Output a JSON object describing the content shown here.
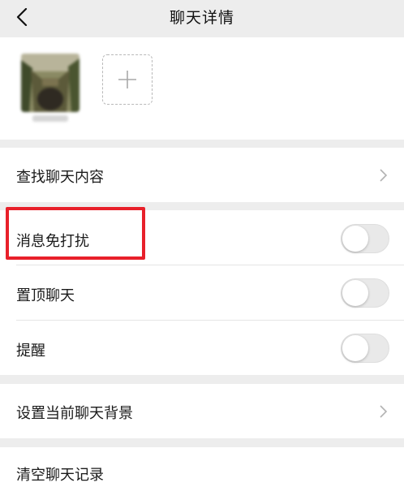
{
  "header": {
    "title": "聊天详情",
    "back_icon": "chevron-left-icon"
  },
  "members": {
    "add_icon": "plus-icon"
  },
  "rows": {
    "search_chat": {
      "label": "查找聊天内容",
      "icon": "chevron-right-icon"
    },
    "mute": {
      "label": "消息免打扰",
      "on": false
    },
    "pin": {
      "label": "置顶聊天",
      "on": false
    },
    "remind": {
      "label": "提醒",
      "on": false
    },
    "background": {
      "label": "设置当前聊天背景",
      "icon": "chevron-right-icon"
    },
    "clear": {
      "label": "清空聊天记录"
    }
  },
  "colors": {
    "page_bg": "#ededed",
    "card_bg": "#ffffff",
    "highlight": "#e8202a",
    "toggle_off": "#e9e9e9"
  }
}
